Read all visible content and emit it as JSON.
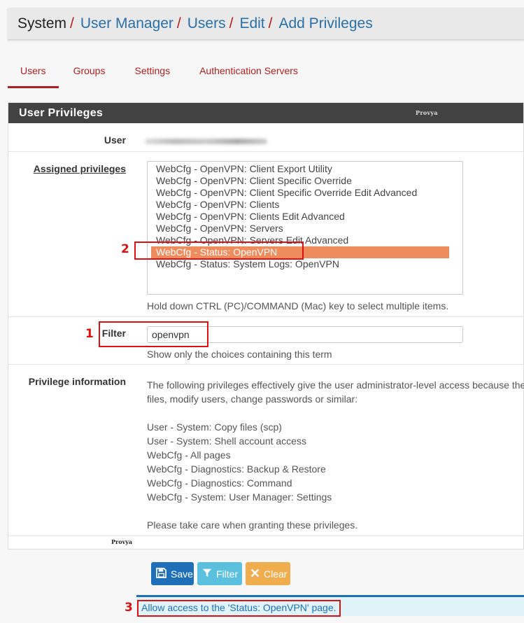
{
  "breadcrumb": {
    "root": "System",
    "separator": "/",
    "links": [
      "User Manager",
      "Users",
      "Edit",
      "Add Privileges"
    ]
  },
  "tabs": [
    {
      "label": "Users",
      "active": true
    },
    {
      "label": "Groups",
      "active": false
    },
    {
      "label": "Settings",
      "active": false
    },
    {
      "label": "Authentication Servers",
      "active": false
    }
  ],
  "panel": {
    "title": "User Privileges",
    "watermark": "Provya",
    "user_label": "User",
    "assigned_label": "Assigned privileges",
    "privileges": [
      {
        "label": "WebCfg - OpenVPN: Client Export Utility",
        "selected": false
      },
      {
        "label": "WebCfg - OpenVPN: Client Specific Override",
        "selected": false
      },
      {
        "label": "WebCfg - OpenVPN: Client Specific Override Edit Advanced",
        "selected": false
      },
      {
        "label": "WebCfg - OpenVPN: Clients",
        "selected": false
      },
      {
        "label": "WebCfg - OpenVPN: Clients Edit Advanced",
        "selected": false
      },
      {
        "label": "WebCfg - OpenVPN: Servers",
        "selected": false
      },
      {
        "label": "WebCfg - OpenVPN: Servers Edit Advanced",
        "selected": false
      },
      {
        "label": "WebCfg - Status: OpenVPN",
        "selected": true
      },
      {
        "label": "WebCfg - Status: System Logs: OpenVPN",
        "selected": false
      }
    ],
    "assigned_help": "Hold down CTRL (PC)/COMMAND (Mac) key to select multiple items.",
    "filter_label": "Filter",
    "filter_value": "openvpn",
    "filter_help": "Show only the choices containing this term",
    "info_label": "Privilege information",
    "info_lines": [
      "The following privileges effectively give the user administrator-level access because the",
      "files, modify users, change passwords or similar:",
      "",
      "User - System: Copy files (scp)",
      "User - System: Shell account access",
      "WebCfg - All pages",
      "WebCfg - Diagnostics: Backup & Restore",
      "WebCfg - Diagnostics: Command",
      "WebCfg - System: User Manager: Settings",
      "",
      "Please take care when granting these privileges."
    ]
  },
  "buttons": {
    "save": "Save",
    "filter": "Filter",
    "clear": "Clear"
  },
  "alert": "Allow access to the 'Status: OpenVPN' page.",
  "markers": [
    "1",
    "2",
    "3"
  ],
  "colors": {
    "accent": "#b02020",
    "selected": "#ef8c5e",
    "annotation": "#dd1111"
  }
}
